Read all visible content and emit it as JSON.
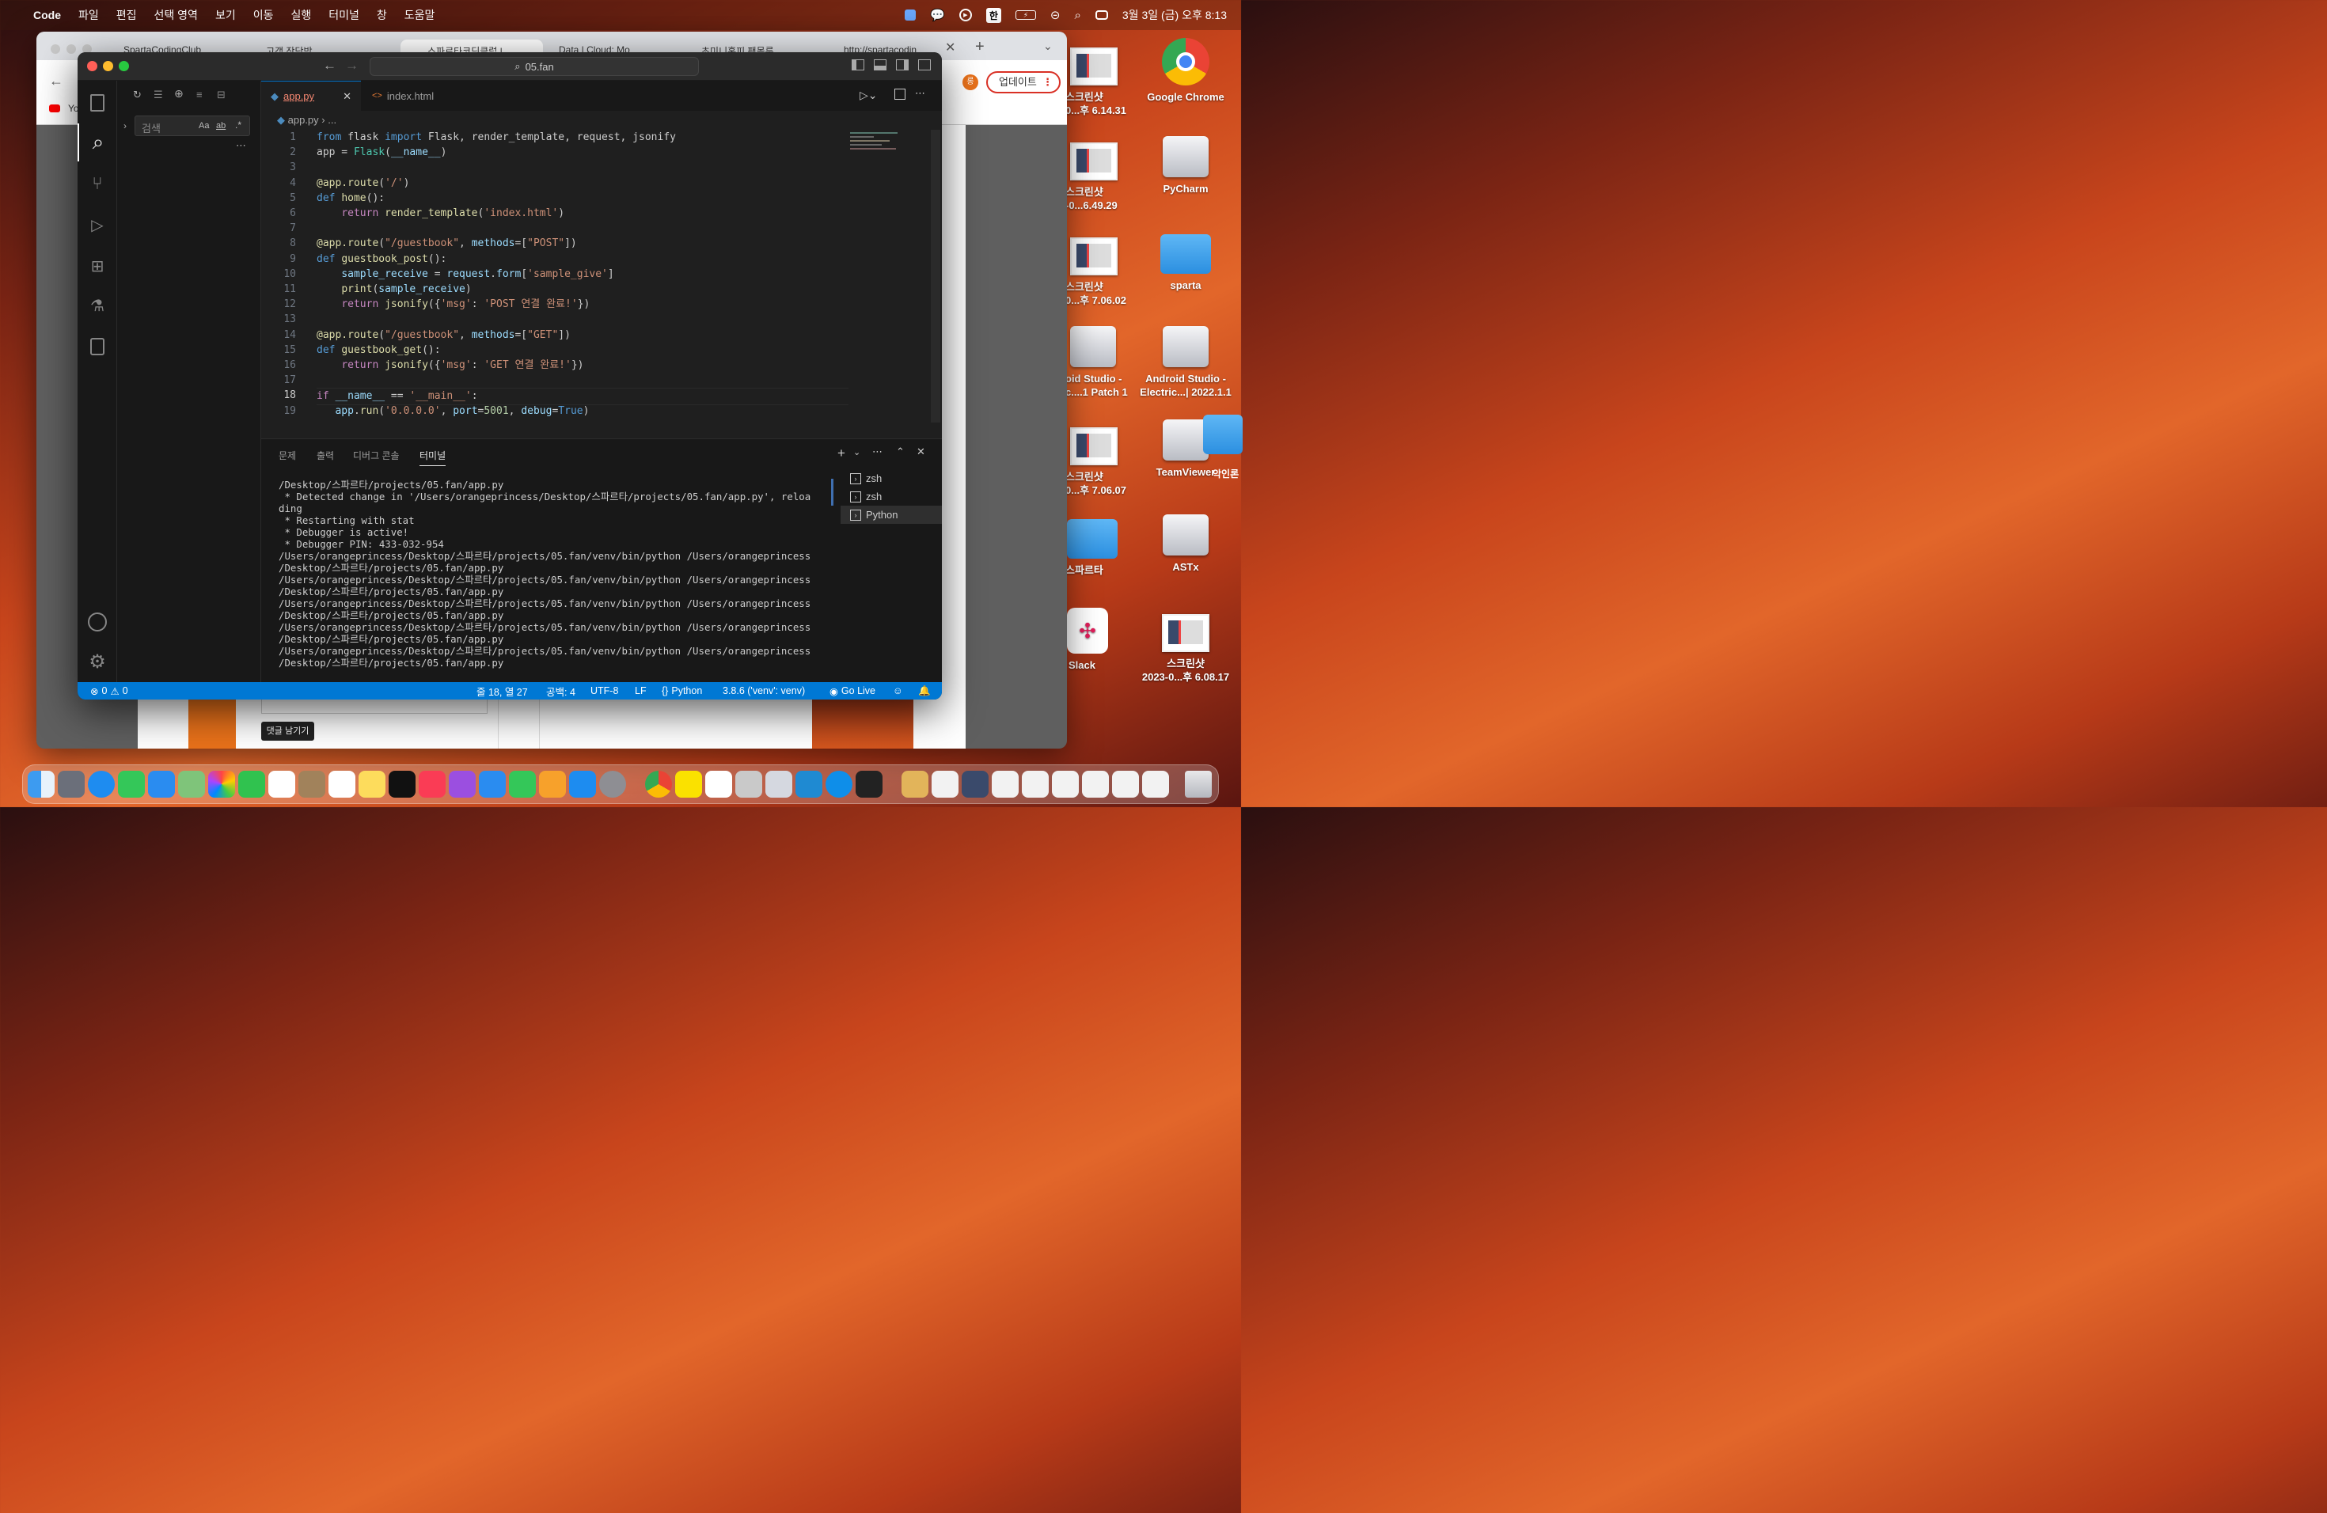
{
  "menubar": {
    "app": "Code",
    "items": [
      "파일",
      "편집",
      "선택 영역",
      "보기",
      "이동",
      "실행",
      "터미널",
      "창",
      "도움말"
    ],
    "ime": "한",
    "clock": "3월 3일 (금) 오후 8:13"
  },
  "desktop": {
    "right_col": [
      {
        "label": "Google Chrome",
        "kind": "chrome"
      },
      {
        "label": "PyCharm",
        "kind": "drive"
      },
      {
        "label": "sparta",
        "kind": "folder"
      },
      {
        "label": "Android Studio -\nElectric...| 2022.1.1",
        "kind": "drive"
      },
      {
        "label": "TeamViewer",
        "kind": "drive"
      },
      {
        "label": "ASTx",
        "kind": "drive"
      },
      {
        "label": "스크린샷\n2023-0...후 6.08.17",
        "kind": "thumb"
      }
    ],
    "left_col": [
      {
        "label": "스크린샷\n0...후 6.14.31",
        "kind": "thumb"
      },
      {
        "label": "스크린샷\n-0...6.49.29",
        "kind": "thumb"
      },
      {
        "label": "스크린샷\n0...후 7.06.02",
        "kind": "thumb"
      },
      {
        "label": "oid Studio -\nc....1 Patch 1",
        "kind": "drive"
      },
      {
        "label": "스크린샷\n0...후 7.06.07",
        "kind": "thumb"
      },
      {
        "label": "스파르타",
        "kind": "folder"
      },
      {
        "label": "Slack",
        "kind": "slack"
      }
    ],
    "partial_label": "악인론"
  },
  "chrome": {
    "tabs": [
      "SpartaCodingClub",
      "고객 작당방",
      "스파르타코딩클럽 |",
      "Data | Cloud: Mo",
      "초미니홈피 팬몰룩",
      "http://spartacodin"
    ],
    "update_button": "업데이트",
    "avatar_letter": "롱",
    "youtube_text": "Yo",
    "comment_button": "댓글 남기기"
  },
  "vscode": {
    "search_text": "05.fan",
    "sidebar": {
      "search_placeholder": "검색",
      "opt_case": "Aa",
      "opt_word": "ab",
      "opt_regex": ".*"
    },
    "tabs": [
      {
        "label": "app.py",
        "active": true
      },
      {
        "label": "index.html",
        "active": false
      }
    ],
    "breadcrumb": [
      "app.py",
      "..."
    ],
    "code": [
      [
        [
          "k",
          "from "
        ],
        [
          "t",
          "flask "
        ],
        [
          "k",
          "import "
        ],
        [
          "t",
          "Flask, render_template, request, jsonify"
        ]
      ],
      [
        [
          "t",
          "app = "
        ],
        [
          "c",
          "Flask"
        ],
        [
          "t",
          "("
        ],
        [
          "v",
          "__name__"
        ],
        [
          "t",
          ")"
        ]
      ],
      [],
      [
        [
          "f",
          "@app.route"
        ],
        [
          "t",
          "("
        ],
        [
          "s",
          "'/'"
        ],
        [
          "t",
          ")"
        ]
      ],
      [
        [
          "k",
          "def "
        ],
        [
          "f",
          "home"
        ],
        [
          "t",
          "():"
        ]
      ],
      [
        [
          "t",
          "    "
        ],
        [
          "kc",
          "return "
        ],
        [
          "f",
          "render_template"
        ],
        [
          "t",
          "("
        ],
        [
          "s",
          "'index.html'"
        ],
        [
          "t",
          ")"
        ]
      ],
      [],
      [
        [
          "f",
          "@app.route"
        ],
        [
          "t",
          "("
        ],
        [
          "s",
          "\"/guestbook\""
        ],
        [
          "t",
          ", "
        ],
        [
          "v",
          "methods"
        ],
        [
          "t",
          "=["
        ],
        [
          "s",
          "\"POST\""
        ],
        [
          "t",
          "])"
        ]
      ],
      [
        [
          "k",
          "def "
        ],
        [
          "f",
          "guestbook_post"
        ],
        [
          "t",
          "():"
        ]
      ],
      [
        [
          "t",
          "    "
        ],
        [
          "v",
          "sample_receive"
        ],
        [
          "t",
          " = "
        ],
        [
          "v",
          "request"
        ],
        [
          "t",
          "."
        ],
        [
          "v",
          "form"
        ],
        [
          "t",
          "["
        ],
        [
          "s",
          "'sample_give'"
        ],
        [
          "t",
          "]"
        ]
      ],
      [
        [
          "t",
          "    "
        ],
        [
          "f",
          "print"
        ],
        [
          "t",
          "("
        ],
        [
          "v",
          "sample_receive"
        ],
        [
          "t",
          ")"
        ]
      ],
      [
        [
          "t",
          "    "
        ],
        [
          "kc",
          "return "
        ],
        [
          "f",
          "jsonify"
        ],
        [
          "t",
          "({"
        ],
        [
          "s",
          "'msg'"
        ],
        [
          "t",
          ": "
        ],
        [
          "s",
          "'POST 연결 완료!'"
        ],
        [
          "t",
          "})"
        ]
      ],
      [],
      [
        [
          "f",
          "@app.route"
        ],
        [
          "t",
          "("
        ],
        [
          "s",
          "\"/guestbook\""
        ],
        [
          "t",
          ", "
        ],
        [
          "v",
          "methods"
        ],
        [
          "t",
          "=["
        ],
        [
          "s",
          "\"GET\""
        ],
        [
          "t",
          "])"
        ]
      ],
      [
        [
          "k",
          "def "
        ],
        [
          "f",
          "guestbook_get"
        ],
        [
          "t",
          "():"
        ]
      ],
      [
        [
          "t",
          "    "
        ],
        [
          "kc",
          "return "
        ],
        [
          "f",
          "jsonify"
        ],
        [
          "t",
          "({"
        ],
        [
          "s",
          "'msg'"
        ],
        [
          "t",
          ": "
        ],
        [
          "s",
          "'GET 연결 완료!'"
        ],
        [
          "t",
          "})"
        ]
      ],
      [],
      [
        [
          "kc",
          "if "
        ],
        [
          "v",
          "__name__"
        ],
        [
          "t",
          " == "
        ],
        [
          "s",
          "'__main__'"
        ],
        [
          "t",
          ":"
        ]
      ],
      [
        [
          "t",
          "   "
        ],
        [
          "v",
          "app"
        ],
        [
          "t",
          "."
        ],
        [
          "f",
          "run"
        ],
        [
          "t",
          "("
        ],
        [
          "s",
          "'0.0.0.0'"
        ],
        [
          "t",
          ", "
        ],
        [
          "v",
          "port"
        ],
        [
          "t",
          "="
        ],
        [
          "n",
          "5001"
        ],
        [
          "t",
          ", "
        ],
        [
          "v",
          "debug"
        ],
        [
          "t",
          "="
        ],
        [
          "k",
          "True"
        ],
        [
          "t",
          ")"
        ]
      ]
    ],
    "panel_tabs": [
      "문제",
      "출력",
      "디버그 콘솔",
      "터미널"
    ],
    "terminal_lines": [
      "/Desktop/스파르타/projects/05.fan/app.py",
      " * Detected change in '/Users/orangeprincess/Desktop/스파르타/projects/05.fan/app.py', reloa",
      "ding",
      " * Restarting with stat",
      " * Debugger is active!",
      " * Debugger PIN: 433-032-954",
      "/Users/orangeprincess/Desktop/스파르타/projects/05.fan/venv/bin/python /Users/orangeprincess",
      "/Desktop/스파르타/projects/05.fan/app.py",
      "/Users/orangeprincess/Desktop/스파르타/projects/05.fan/venv/bin/python /Users/orangeprincess",
      "/Desktop/스파르타/projects/05.fan/app.py",
      "/Users/orangeprincess/Desktop/스파르타/projects/05.fan/venv/bin/python /Users/orangeprincess",
      "/Desktop/스파르타/projects/05.fan/app.py",
      "/Users/orangeprincess/Desktop/스파르타/projects/05.fan/venv/bin/python /Users/orangeprincess",
      "/Desktop/스파르타/projects/05.fan/app.py",
      "/Users/orangeprincess/Desktop/스파르타/projects/05.fan/venv/bin/python /Users/orangeprincess",
      "/Desktop/스파르타/projects/05.fan/app.py"
    ],
    "terminals": [
      "zsh",
      "zsh",
      "Python"
    ],
    "status": {
      "errors": "0",
      "warnings": "0",
      "position": "줄 18, 열 27",
      "spaces": "공백: 4",
      "encoding": "UTF-8",
      "eol": "LF",
      "language": "Python",
      "interpreter": "3.8.6 ('venv': venv)",
      "golive": "Go Live"
    }
  },
  "colors": {
    "accent": "#0078d4",
    "status_bar": "#0078d4"
  }
}
